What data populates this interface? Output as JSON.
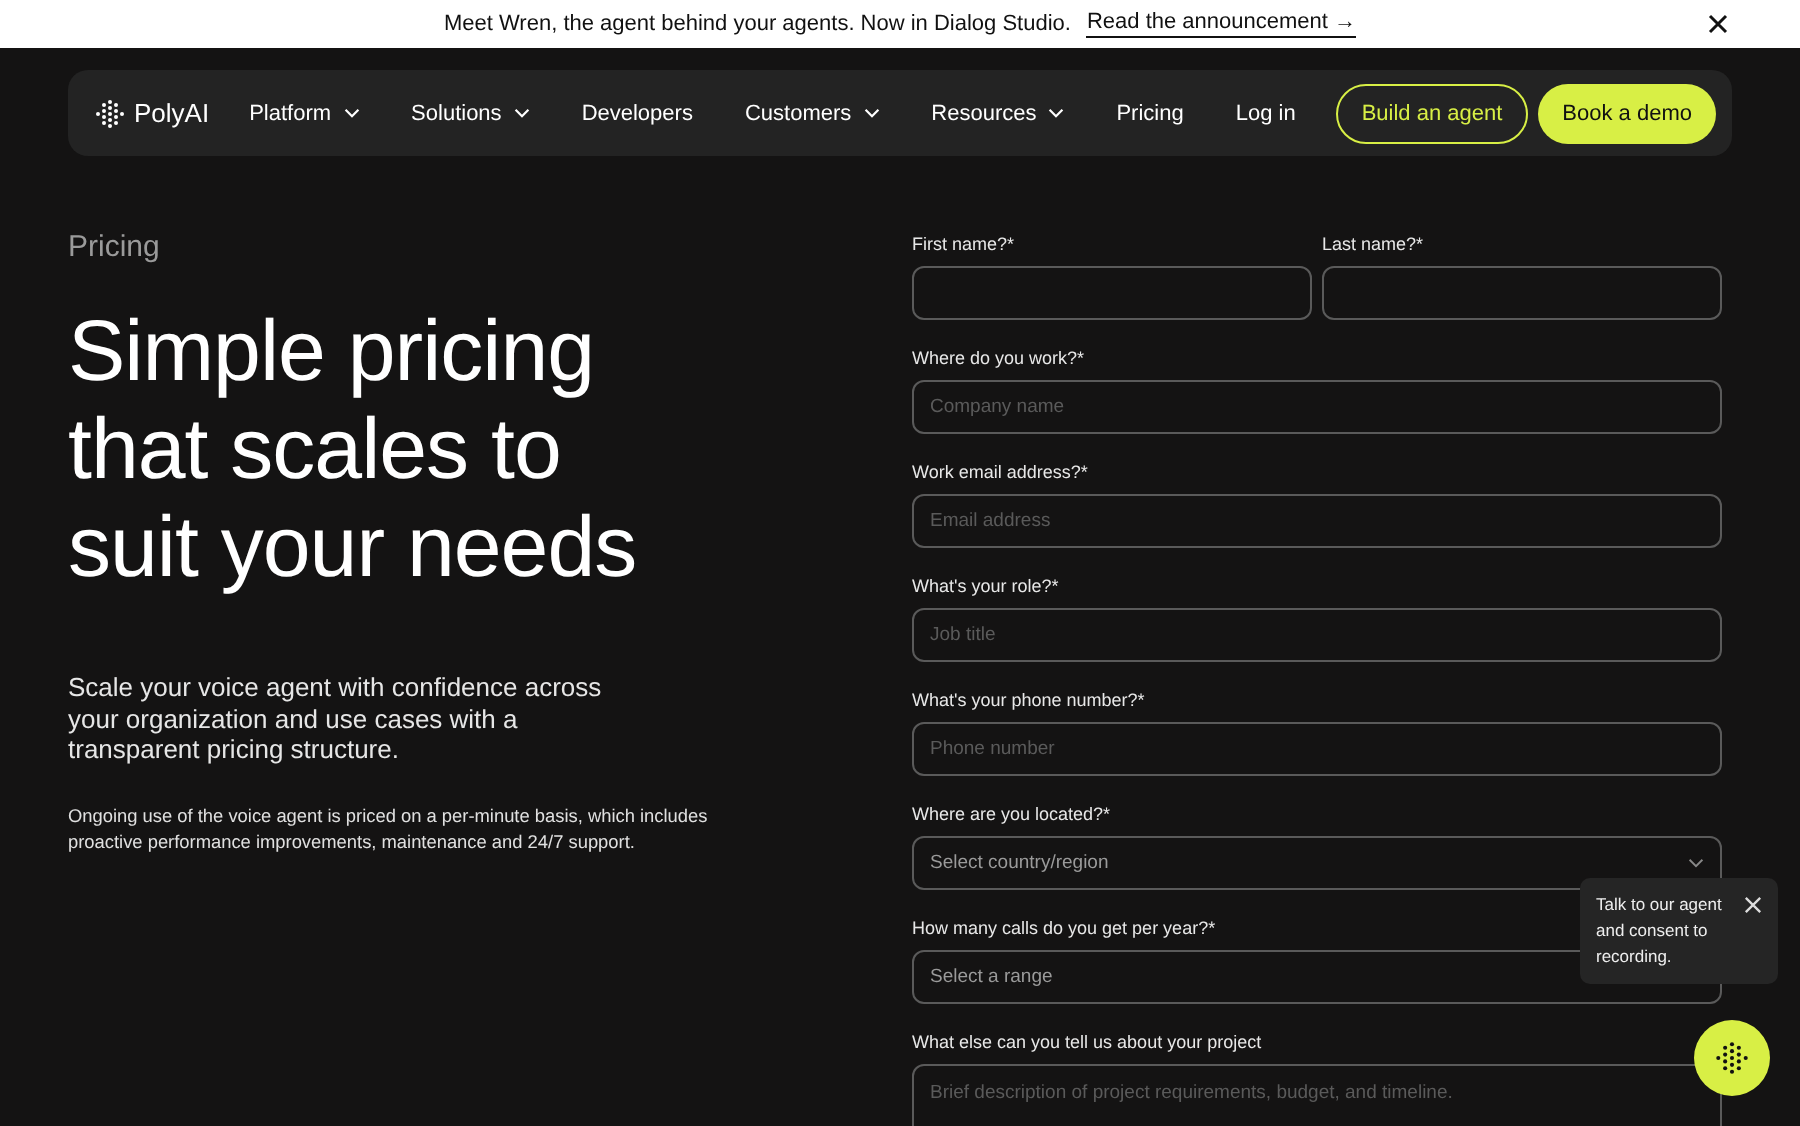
{
  "announcement": {
    "text": "Meet Wren, the agent behind your agents. Now in Dialog Studio.",
    "link": "Read the announcement →"
  },
  "nav": {
    "logo": "PolyAI",
    "items": [
      {
        "label": "Platform",
        "dropdown": true
      },
      {
        "label": "Solutions",
        "dropdown": true
      },
      {
        "label": "Developers",
        "dropdown": false
      },
      {
        "label": "Customers",
        "dropdown": true
      },
      {
        "label": "Resources",
        "dropdown": true
      },
      {
        "label": "Pricing",
        "dropdown": false
      }
    ],
    "login": "Log in",
    "buttons": [
      {
        "label": "Build an agent",
        "kind": "outline"
      },
      {
        "label": "Book a demo",
        "kind": "filled"
      }
    ]
  },
  "hero": {
    "eyebrow": "Pricing",
    "heading": [
      "Simple pricing",
      "that scales to",
      "suit your needs"
    ],
    "intro": "Scale your voice agent with confidence across your organization and use cases with a transparent pricing structure.",
    "note": "Ongoing use of the voice agent is priced on a per-minute basis, which includes proactive performance improvements, maintenance and 24/7 support."
  },
  "form": {
    "rows": [
      [
        {
          "label": "First name?*",
          "kind": "text"
        },
        {
          "label": "Last name?*",
          "kind": "text"
        }
      ],
      [
        {
          "label": "Where do you work?*",
          "kind": "text",
          "placeholder": "Company name"
        }
      ],
      [
        {
          "label": "Work email address?*",
          "kind": "text",
          "placeholder": "Email address"
        }
      ],
      [
        {
          "label": "What's your role?*",
          "kind": "text",
          "placeholder": "Job title"
        }
      ],
      [
        {
          "label": "What's your phone number?*",
          "kind": "text",
          "placeholder": "Phone number"
        }
      ],
      [
        {
          "label": "Where are you located?*",
          "kind": "select",
          "value": "Select country/region"
        }
      ],
      [
        {
          "label": "How many calls do you get per year?*",
          "kind": "select",
          "value": "Select a range"
        }
      ],
      [
        {
          "label": "What else can you tell us about your project",
          "kind": "textarea",
          "placeholder": "Brief description of project requirements, budget, and timeline."
        }
      ]
    ]
  },
  "tooltip": {
    "text": "Talk to our agent and consent to recording."
  }
}
